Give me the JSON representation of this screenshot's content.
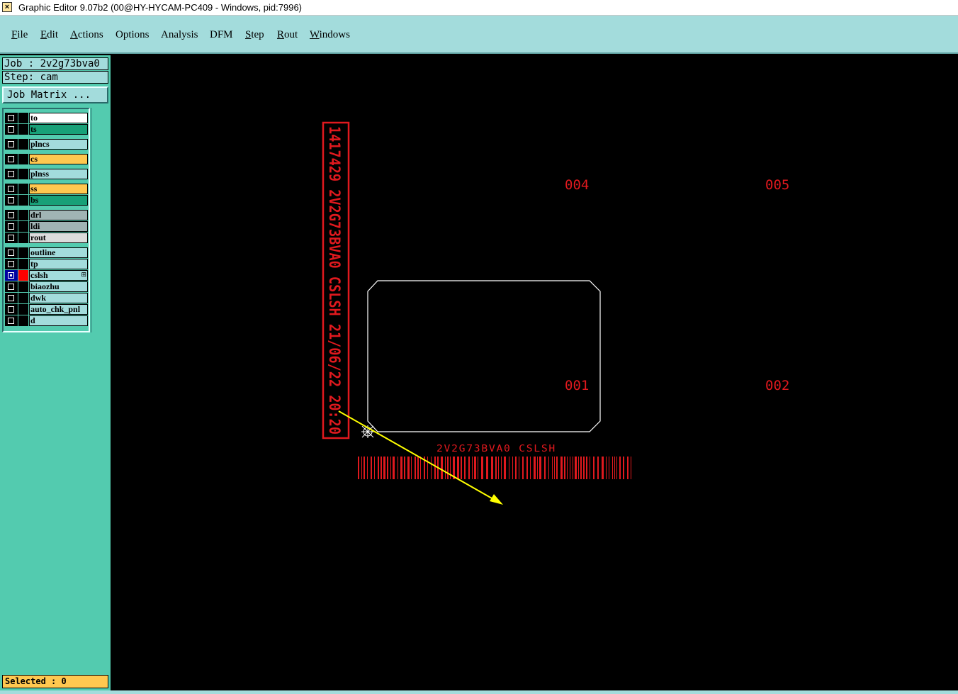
{
  "window": {
    "title": "Graphic Editor 9.07b2 (00@HY-HYCAM-PC409 - Windows, pid:7996)"
  },
  "menu": {
    "items": [
      {
        "first": "F",
        "rest": "ile"
      },
      {
        "first": "E",
        "rest": "dit"
      },
      {
        "first": "A",
        "rest": "ctions"
      },
      {
        "first": "",
        "rest": "Options"
      },
      {
        "first": "",
        "rest": "Analysis"
      },
      {
        "first": "",
        "rest": "DFM"
      },
      {
        "first": "S",
        "rest": "tep"
      },
      {
        "first": "R",
        "rest": "out"
      },
      {
        "first": "W",
        "rest": "indows"
      }
    ]
  },
  "panel": {
    "job_label": "Job : 2v2g73bva0",
    "step_label": "Step: cam",
    "job_matrix_button": "Job Matrix ...",
    "selected_label": "Selected : 0"
  },
  "layers": [
    {
      "name": "to",
      "bg": "#ffffff",
      "active": false
    },
    {
      "name": "ts",
      "bg": "#18a078",
      "active": false
    },
    {
      "name": "plncs",
      "bg": "#a3dcdc",
      "active": false
    },
    {
      "name": "cs",
      "bg": "#ffc850",
      "active": false
    },
    {
      "name": "plnss",
      "bg": "#a3dcdc",
      "active": false
    },
    {
      "name": "ss",
      "bg": "#ffc850",
      "active": false
    },
    {
      "name": "bs",
      "bg": "#18a078",
      "active": false
    },
    {
      "name": "drl",
      "bg": "#a0b4b4",
      "active": false
    },
    {
      "name": "ldi",
      "bg": "#a0b4b4",
      "active": false
    },
    {
      "name": "rout",
      "bg": "#dcdcdc",
      "active": false
    },
    {
      "name": "outline",
      "bg": "#a3dcdc",
      "active": false
    },
    {
      "name": "tp",
      "bg": "#a3dcdc",
      "active": false
    },
    {
      "name": "cslsh",
      "bg": "#a3dcdc",
      "active": true,
      "marker": "⊞"
    },
    {
      "name": "biaozhu",
      "bg": "#a3dcdc",
      "active": false
    },
    {
      "name": "dwk",
      "bg": "#a3dcdc",
      "active": false
    },
    {
      "name": "auto_chk_pnl",
      "bg": "#a3dcdc",
      "active": false
    },
    {
      "name": "d",
      "bg": "#a3dcdc",
      "active": false
    }
  ],
  "canvas": {
    "vertical_text": "1417429 2V2G73BVA0 CSLSH 21/06/22 20:20",
    "barcode_text": "2V2G73BVA0 CSLSH",
    "pcs_labels": [
      "004",
      "005",
      "001",
      "002"
    ],
    "feature_color": "#e0191e",
    "outline_color": "#ffffff",
    "measure_color": "#ffff00"
  },
  "colors": {
    "menubar": "#a3dcdc",
    "panel": "#53cbaf",
    "canvas_bg": "#000000",
    "selected_bg": "#ffc850"
  }
}
